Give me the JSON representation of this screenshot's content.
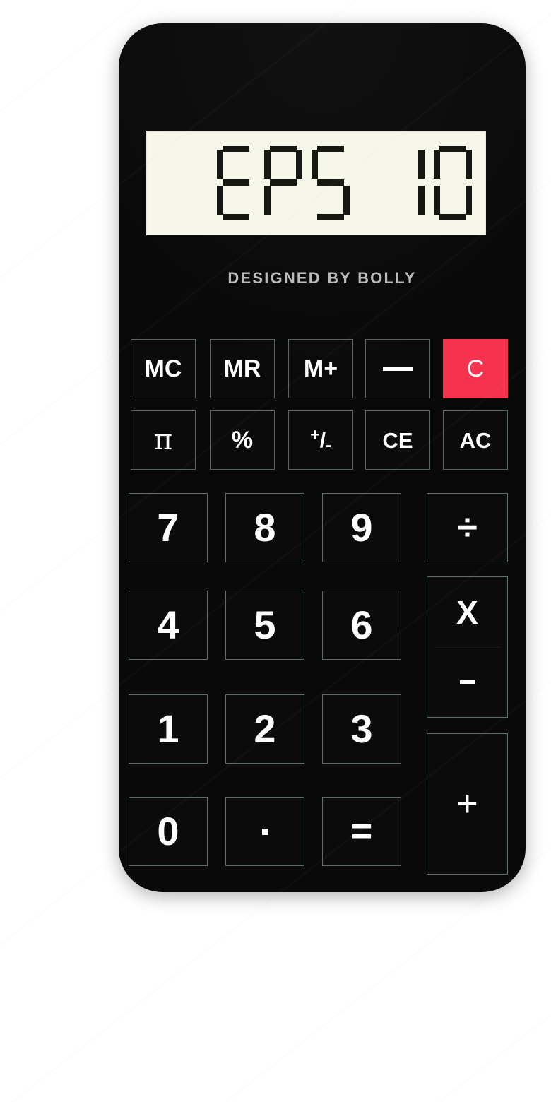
{
  "device": {
    "name": "pocket-calculator",
    "body_color": "#090909",
    "accent_color": "#f5334f",
    "display_bg": "#f7f6ea",
    "display_segment_color": "#14140f"
  },
  "display": {
    "value": "EPS 10",
    "segments": [
      "E",
      "P",
      "S",
      " ",
      "1",
      "0"
    ]
  },
  "brand": {
    "text": "DESIGNED BY BOLLY"
  },
  "keypad": {
    "row_memory": [
      {
        "label": "MC",
        "name": "memory-clear"
      },
      {
        "label": "MR",
        "name": "memory-recall"
      },
      {
        "label": "M+",
        "name": "memory-add"
      },
      {
        "label": "—",
        "name": "memory-subtract"
      },
      {
        "label": "C",
        "name": "clear"
      }
    ],
    "row_function": [
      {
        "label": "π",
        "name": "pi"
      },
      {
        "label": "%",
        "name": "percent"
      },
      {
        "label": "+/-",
        "name": "sign-toggle"
      },
      {
        "label": "CE",
        "name": "clear-entry"
      },
      {
        "label": "AC",
        "name": "all-clear"
      }
    ],
    "row_789": [
      {
        "label": "7",
        "name": "digit-7"
      },
      {
        "label": "8",
        "name": "digit-8"
      },
      {
        "label": "9",
        "name": "digit-9"
      }
    ],
    "row_456": [
      {
        "label": "4",
        "name": "digit-4"
      },
      {
        "label": "5",
        "name": "digit-5"
      },
      {
        "label": "6",
        "name": "digit-6"
      }
    ],
    "row_123": [
      {
        "label": "1",
        "name": "digit-1"
      },
      {
        "label": "2",
        "name": "digit-2"
      },
      {
        "label": "3",
        "name": "digit-3"
      }
    ],
    "row_bottom": [
      {
        "label": "0",
        "name": "digit-0"
      },
      {
        "label": ".",
        "name": "decimal-point"
      },
      {
        "label": "=",
        "name": "equals"
      }
    ],
    "operators": {
      "divide": "÷",
      "multiply": "X",
      "subtract": "-",
      "add": "+"
    }
  }
}
